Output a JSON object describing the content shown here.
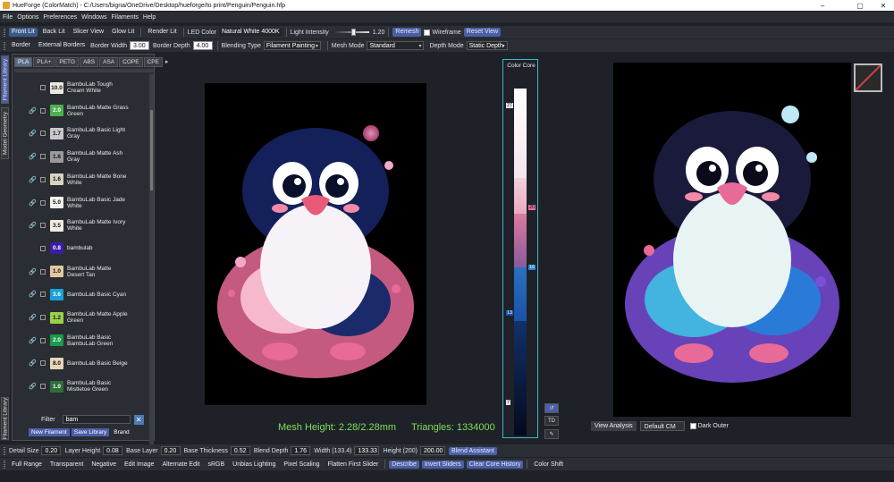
{
  "window": {
    "title": "HueForge (ColorMatch) - C:/Users/bigna/OneDrive/Desktop/hueforge/to print/Penguin/Penguin.hfp",
    "minimize": "–",
    "maximize": "▢",
    "close": "✕"
  },
  "menu": [
    "File",
    "Options",
    "Preferences",
    "Windows",
    "Filaments",
    "Help"
  ],
  "toolbar1": {
    "buttons": [
      "Front Lit",
      "Back Lit",
      "Slicer View",
      "Glow Lit",
      "Render Lit"
    ],
    "led_label": "LED Color",
    "led_value": "Natural White 4000K",
    "light_label": "Light Intensity",
    "light_value": "1.20",
    "light_level": 0.6,
    "remesh": "Remesh",
    "wireframe": "Wireframe",
    "reset": "Reset View"
  },
  "toolbar2": {
    "border": "Border",
    "ext_borders": "External Borders",
    "border_width_label": "Border Width",
    "border_width": "3.00",
    "border_depth_label": "Border Depth",
    "border_depth": "4.00",
    "blending_label": "Blending Type",
    "blending_value": "Filament Painting",
    "mesh_label": "Mesh Mode",
    "mesh_value": "Standard",
    "depth_label": "Depth Mode",
    "depth_value": "Static Depth"
  },
  "side_tabs": [
    "Filament Library",
    "Model Geometry",
    "Filament Library"
  ],
  "library": {
    "tabs": [
      "PLA",
      "PLA+",
      "PETG",
      "ABS",
      "ASA",
      "COPE",
      "CPE"
    ],
    "items": [
      {
        "td": "10.0",
        "name": "BambuLab Tough Cream White",
        "color": "#ece9df",
        "fg": "#111",
        "link": false
      },
      {
        "td": "2.0",
        "name": "BambuLab Matte Grass Green",
        "color": "#4caf50",
        "fg": "#fff",
        "link": true
      },
      {
        "td": "1.7",
        "name": "BambuLab Basic Light Gray",
        "color": "#c8c8c8",
        "fg": "#111",
        "link": true
      },
      {
        "td": "1.6",
        "name": "BambuLab Matte Ash Gray",
        "color": "#9a9a9a",
        "fg": "#111",
        "link": true
      },
      {
        "td": "1.6",
        "name": "BambuLab Matte Bone White",
        "color": "#d8d2c0",
        "fg": "#111",
        "link": true
      },
      {
        "td": "5.0",
        "name": "BambuLab Basic Jade White",
        "color": "#f2f2ee",
        "fg": "#111",
        "link": true
      },
      {
        "td": "3.5",
        "name": "BambuLab Matte Ivory White",
        "color": "#f0ece0",
        "fg": "#111",
        "link": true
      },
      {
        "td": "0.8",
        "name": "bambulab",
        "color": "#3a1ea8",
        "fg": "#fff",
        "link": false
      },
      {
        "td": "1.0",
        "name": "BambuLab Matte Desert Tan",
        "color": "#e0c8a0",
        "fg": "#111",
        "link": true
      },
      {
        "td": "3.6",
        "name": "BambuLab Basic Cyan",
        "color": "#1aa0d8",
        "fg": "#fff",
        "link": true
      },
      {
        "td": "1.2",
        "name": "BambuLab Matte Apple Green",
        "color": "#9ad04a",
        "fg": "#111",
        "link": true
      },
      {
        "td": "2.0",
        "name": "BambuLab Basic BambuLab Green",
        "color": "#1a9a4a",
        "fg": "#fff",
        "link": true
      },
      {
        "td": "8.0",
        "name": "BambuLab Basic Beige",
        "color": "#e8d6b6",
        "fg": "#111",
        "link": true
      },
      {
        "td": "1.0",
        "name": "BambuLab Basic Mistletoe Green",
        "color": "#2e6e3a",
        "fg": "#fff",
        "link": true
      }
    ],
    "filter_label": "Filter",
    "filter_value": "bam",
    "new_btn": "New Filament",
    "save_btn": "Save Library",
    "brand_btn": "Brand"
  },
  "status": {
    "mesh_height": "Mesh Height: 2.28/2.28mm",
    "triangles": "Triangles: 1334000"
  },
  "color_core": {
    "title": "Color Core",
    "markers": [
      "27",
      "20",
      "16",
      "13",
      "7"
    ],
    "buttons": [
      "↺",
      "TD",
      "✎"
    ]
  },
  "view": {
    "analysis": "View Analysis",
    "cm": "Default CM",
    "dark_outer": "Dark Outer"
  },
  "bottom1": {
    "detail_label": "Detail Size",
    "detail": "0.20",
    "layer_label": "Layer Height",
    "layer": "0.08",
    "base_label": "Base Layer",
    "base": "0.20",
    "thick_label": "Base Thickness",
    "thick": "0.52",
    "blend_label": "Blend Depth",
    "blend": "1.76",
    "width_label": "Width (133.4)",
    "width": "133.33",
    "height_label": "Height (200)",
    "height": "200.00",
    "assistant": "Blend Assistant"
  },
  "bottom2": [
    "Full Range",
    "Transparent",
    "Negative",
    "Edit Image",
    "Alternate Edit",
    "sRGB",
    "Unbias Lighting",
    "Pixel Scaling",
    "Flatten First Slider",
    "Describe",
    "Invert Sliders",
    "Clear Core History",
    "Color Shift"
  ]
}
